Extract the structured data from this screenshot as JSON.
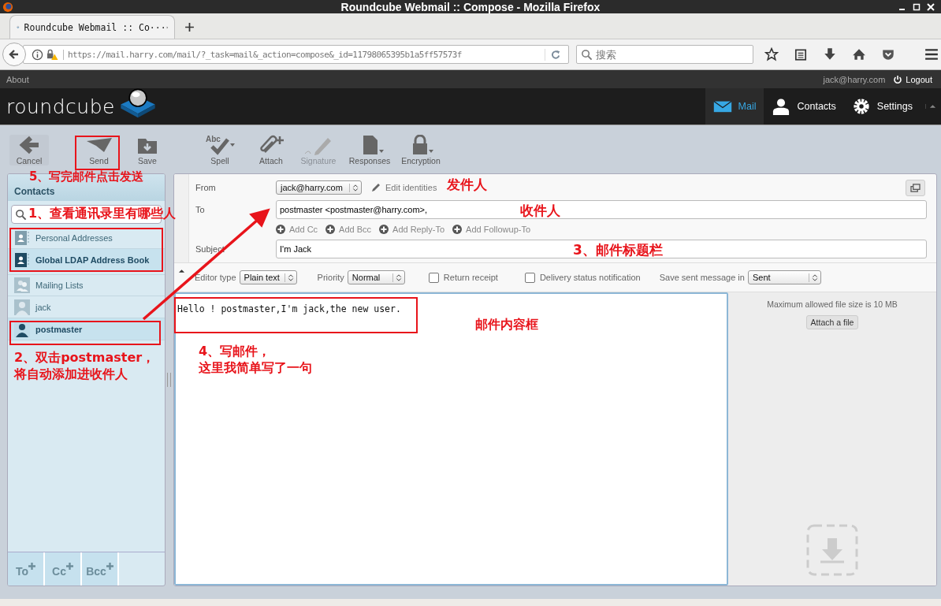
{
  "browser": {
    "window_title": "Roundcube Webmail :: Compose - Mozilla Firefox",
    "tab_title": "Roundcube Webmail :: Co···",
    "url": "https://mail.harry.com/mail/?_task=mail&_action=compose&_id=11798065395b1a5ff57573f",
    "search_placeholder": "搜索"
  },
  "logo": "roundcube",
  "topbar": {
    "about": "About",
    "user": "jack@harry.com",
    "logout": "Logout"
  },
  "nav": [
    {
      "label": "Mail",
      "kind": "mail",
      "selected": true
    },
    {
      "label": "Contacts",
      "kind": "contacts",
      "selected": false
    },
    {
      "label": "Settings",
      "kind": "settings",
      "selected": false
    }
  ],
  "toolbar": [
    {
      "label": "Cancel",
      "kind": "back",
      "disabled": false
    },
    {
      "label": "Send",
      "kind": "send",
      "disabled": false
    },
    {
      "label": "Save",
      "kind": "save",
      "disabled": false
    },
    {
      "label": "Spell",
      "kind": "spell",
      "disabled": false,
      "icon_text": "Abc"
    },
    {
      "label": "Attach",
      "kind": "attach",
      "disabled": false
    },
    {
      "label": "Signature",
      "kind": "signature",
      "disabled": true
    },
    {
      "label": "Responses",
      "kind": "responses",
      "disabled": false
    },
    {
      "label": "Encryption",
      "kind": "encryption",
      "disabled": false
    }
  ],
  "contacts": {
    "title": "Contacts",
    "entries": [
      {
        "kind": "source",
        "label": "Personal Addresses",
        "selected": false
      },
      {
        "kind": "source",
        "label": "Global LDAP Address Book",
        "selected": true
      },
      {
        "kind": "group",
        "label": "Mailing Lists",
        "selected": false
      },
      {
        "kind": "contact",
        "label": "jack",
        "selected": false
      },
      {
        "kind": "contact",
        "label": "postmaster",
        "selected": true
      }
    ],
    "add_buttons": [
      "To",
      "Cc",
      "Bcc"
    ]
  },
  "compose": {
    "from_label": "From",
    "from": "jack@harry.com",
    "edit_identities": "Edit identities",
    "to_label": "To",
    "to": "postmaster <postmaster@harry.com>,",
    "add_links": [
      "Add Cc",
      "Add Bcc",
      "Add Reply-To",
      "Add Followup-To"
    ],
    "subject_label": "Subject",
    "subject": "I'm Jack",
    "editor_type_label": "Editor type",
    "editor_type": "Plain text",
    "priority_label": "Priority",
    "priority": "Normal",
    "checkboxes": [
      {
        "label": "Return receipt",
        "checked": false
      },
      {
        "label": "Delivery status notification",
        "checked": false
      }
    ],
    "save_sent_label": "Save sent message in",
    "save_sent": "Sent",
    "body": "Hello ! postmaster,I'm jack,the new user.",
    "max_size": "Maximum allowed file size is 10 MB",
    "attach_button": "Attach a file"
  },
  "annotations": [
    {
      "lines": [
        "5、写完邮件点击发送"
      ]
    },
    {
      "lines": [
        "1、查看通讯录里有哪些人"
      ]
    },
    {
      "lines": [
        "2、双击postmaster，",
        "将自动添加进收件人"
      ]
    },
    {
      "lines": [
        "发件人"
      ]
    },
    {
      "lines": [
        "收件人"
      ]
    },
    {
      "lines": [
        "3、邮件标题栏"
      ]
    },
    {
      "lines": [
        "邮件内容框"
      ]
    },
    {
      "lines": [
        "4、写邮件，",
        "这里我简单写了一句"
      ]
    }
  ]
}
